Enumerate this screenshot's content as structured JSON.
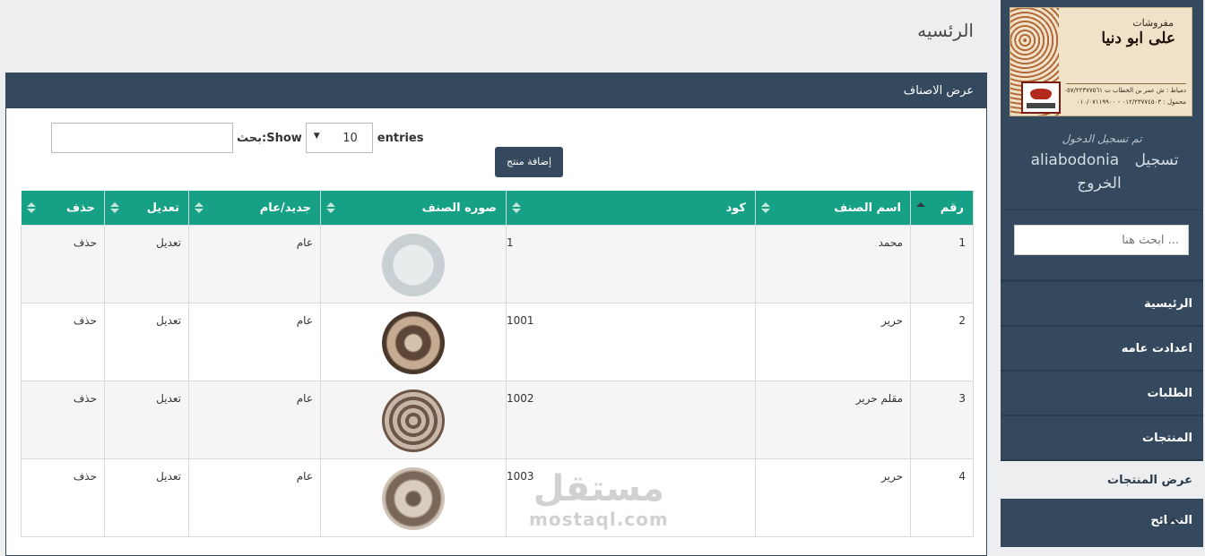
{
  "page": {
    "title": "الرئسيه"
  },
  "panel": {
    "heading": "عرض الاصناف"
  },
  "table_controls": {
    "show_label": "Show",
    "entries_value": "10",
    "entries_label": "entries",
    "search_label": "بحث:",
    "add_button": "إضافة منتج"
  },
  "table": {
    "columns": [
      "رقم",
      "اسم الصنف",
      "كود",
      "صوره الصنف",
      "جديد/عام",
      "تعديل",
      "حذف"
    ],
    "rows": [
      {
        "num": "1",
        "name": "محمد",
        "code": "1",
        "type": "عام",
        "edit": "تعديل",
        "delete": "حذف"
      },
      {
        "num": "2",
        "name": "حرير",
        "code": "1001",
        "type": "عام",
        "edit": "تعديل",
        "delete": "حذف"
      },
      {
        "num": "3",
        "name": "مقلم حرير",
        "code": "1002",
        "type": "عام",
        "edit": "تعديل",
        "delete": "حذف"
      },
      {
        "num": "4",
        "name": "حرير",
        "code": "1003",
        "type": "عام",
        "edit": "تعديل",
        "delete": "حذف"
      }
    ]
  },
  "sidebar": {
    "logo": {
      "subtitle": "مفروشات",
      "name": "على ابو دنيا",
      "address_line1": "دمياط : ش عمر بن الخطاب ت ٠٥٧/٢٢٣٧٧٥٦١",
      "address_line2": "محمول : ٠١٢/٢٣٧٧٤٥٠٣ - ٠١٠/٠٧١١٩٩٠٠"
    },
    "logged_in_label": "تم تسجيل الدخول",
    "username": "aliabodonia",
    "logout_label": "تسجيل الخروج",
    "search_placeholder": "ابحث هنا ...",
    "menu": [
      "الرئيسية",
      "اعدادت عامه",
      "الطلبات",
      "المنتجات",
      "عرض المنتجات",
      "النصائح"
    ]
  },
  "watermark": {
    "arabic": "مستقل",
    "latin": "mostaql.com"
  }
}
